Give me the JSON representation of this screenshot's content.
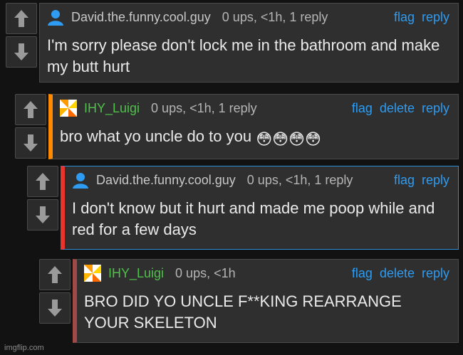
{
  "icons": {
    "upvote": "up-arrow-icon",
    "downvote": "down-arrow-icon",
    "avatar_default": "user-avatar-icon",
    "avatar_pinwheel": "pinwheel-avatar-icon"
  },
  "colors": {
    "page_bg": "#121212",
    "box_bg": "#2f2f2f",
    "link": "#2d9cf2",
    "username_green": "#4fc04a",
    "accent_orange": "#ff8a00",
    "accent_red": "#e8342a",
    "accent_maroon": "#a04a47"
  },
  "comments": [
    {
      "username": "David.the.funny.cool.guy",
      "meta": "0 ups, <1h, 1 reply",
      "actions": {
        "flag": "flag",
        "reply": "reply"
      },
      "text": "I'm sorry please don't lock me in the bathroom and make my butt hurt"
    },
    {
      "username": "IHY_Luigi",
      "meta": "0 ups, <1h, 1 reply",
      "actions": {
        "flag": "flag",
        "delete": "delete",
        "reply": "reply"
      },
      "text": "bro what yo uncle do to you",
      "emojis": "😳😳😳😳"
    },
    {
      "username": "David.the.funny.cool.guy",
      "meta": "0 ups, <1h, 1 reply",
      "actions": {
        "flag": "flag",
        "reply": "reply"
      },
      "text": "I don't know but it hurt and made me poop while and red for a few days"
    },
    {
      "username": "IHY_Luigi",
      "meta": "0 ups, <1h",
      "actions": {
        "flag": "flag",
        "delete": "delete",
        "reply": "reply"
      },
      "text": "BRO DID YO UNCLE F**KING REARRANGE YOUR SKELETON"
    }
  ],
  "watermark": "imgflip.com"
}
